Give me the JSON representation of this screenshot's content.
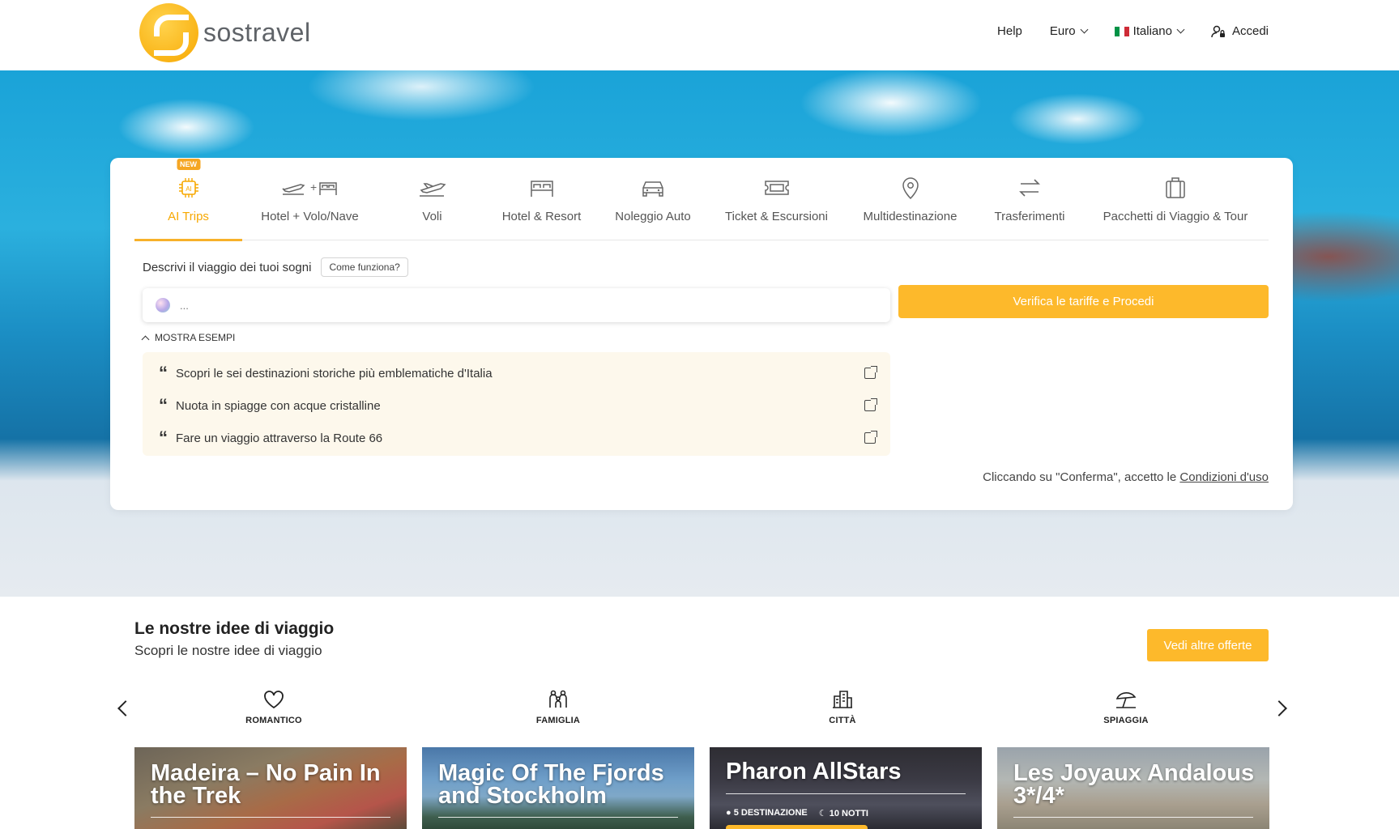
{
  "header": {
    "logo_text": "sostravel",
    "help": "Help",
    "currency": "Euro",
    "language": "Italiano",
    "login": "Accedi"
  },
  "tabs": [
    {
      "label": "AI Trips",
      "badge": "NEW",
      "icon": "ai-chip-icon",
      "active": true
    },
    {
      "label": "Hotel + Volo/Nave",
      "icon": "plane-plus-bed-icon"
    },
    {
      "label": "Voli",
      "icon": "plane-icon"
    },
    {
      "label": "Hotel & Resort",
      "icon": "bed-icon"
    },
    {
      "label": "Noleggio Auto",
      "icon": "car-icon"
    },
    {
      "label": "Ticket & Escursioni",
      "icon": "ticket-icon"
    },
    {
      "label": "Multidestinazione",
      "icon": "map-pin-icon"
    },
    {
      "label": "Trasferimenti",
      "icon": "transfer-arrows-icon"
    },
    {
      "label": "Pacchetti di Viaggio & Tour",
      "icon": "suitcase-icon"
    }
  ],
  "search": {
    "describe_label": "Descrivi il viaggio dei tuoi sogni",
    "how_it_works": "Come funziona?",
    "placeholder": "...",
    "proceed": "Verifica le tariffe e Procedi",
    "show_examples": "MOSTRA ESEMPI",
    "examples": [
      "Scopri le sei destinazioni storiche più emblematiche d'Italia",
      "Nuota in spiagge con acque cristalline",
      "Fare un viaggio attraverso la Route 66"
    ],
    "terms_prefix": "Cliccando su \"Conferma\", accetto le ",
    "terms_link": "Condizioni d'uso"
  },
  "ideas": {
    "title": "Le nostre idee di viaggio",
    "subtitle": "Scopri le nostre idee di viaggio",
    "more_button": "Vedi altre offerte",
    "categories": [
      {
        "label": "ROMANTICO",
        "icon": "heart-icon"
      },
      {
        "label": "FAMIGLIA",
        "icon": "family-icon"
      },
      {
        "label": "CITTÀ",
        "icon": "city-icon"
      },
      {
        "label": "SPIAGGIA",
        "icon": "beach-umbrella-icon"
      }
    ],
    "offers": [
      {
        "title": "Madeira – No Pain In the Trek"
      },
      {
        "title": "Magic Of The Fjords and Stockholm"
      },
      {
        "title": "Pharon AllStars",
        "destinations": "5 DESTINAZIONE",
        "nights": "10 NOTTI"
      },
      {
        "title": "Les Joyaux Andalous 3*/4*"
      }
    ]
  },
  "colors": {
    "accent": "#fdb92b",
    "active_tab": "#f7a800",
    "examples_bg": "#fdf8ec"
  }
}
